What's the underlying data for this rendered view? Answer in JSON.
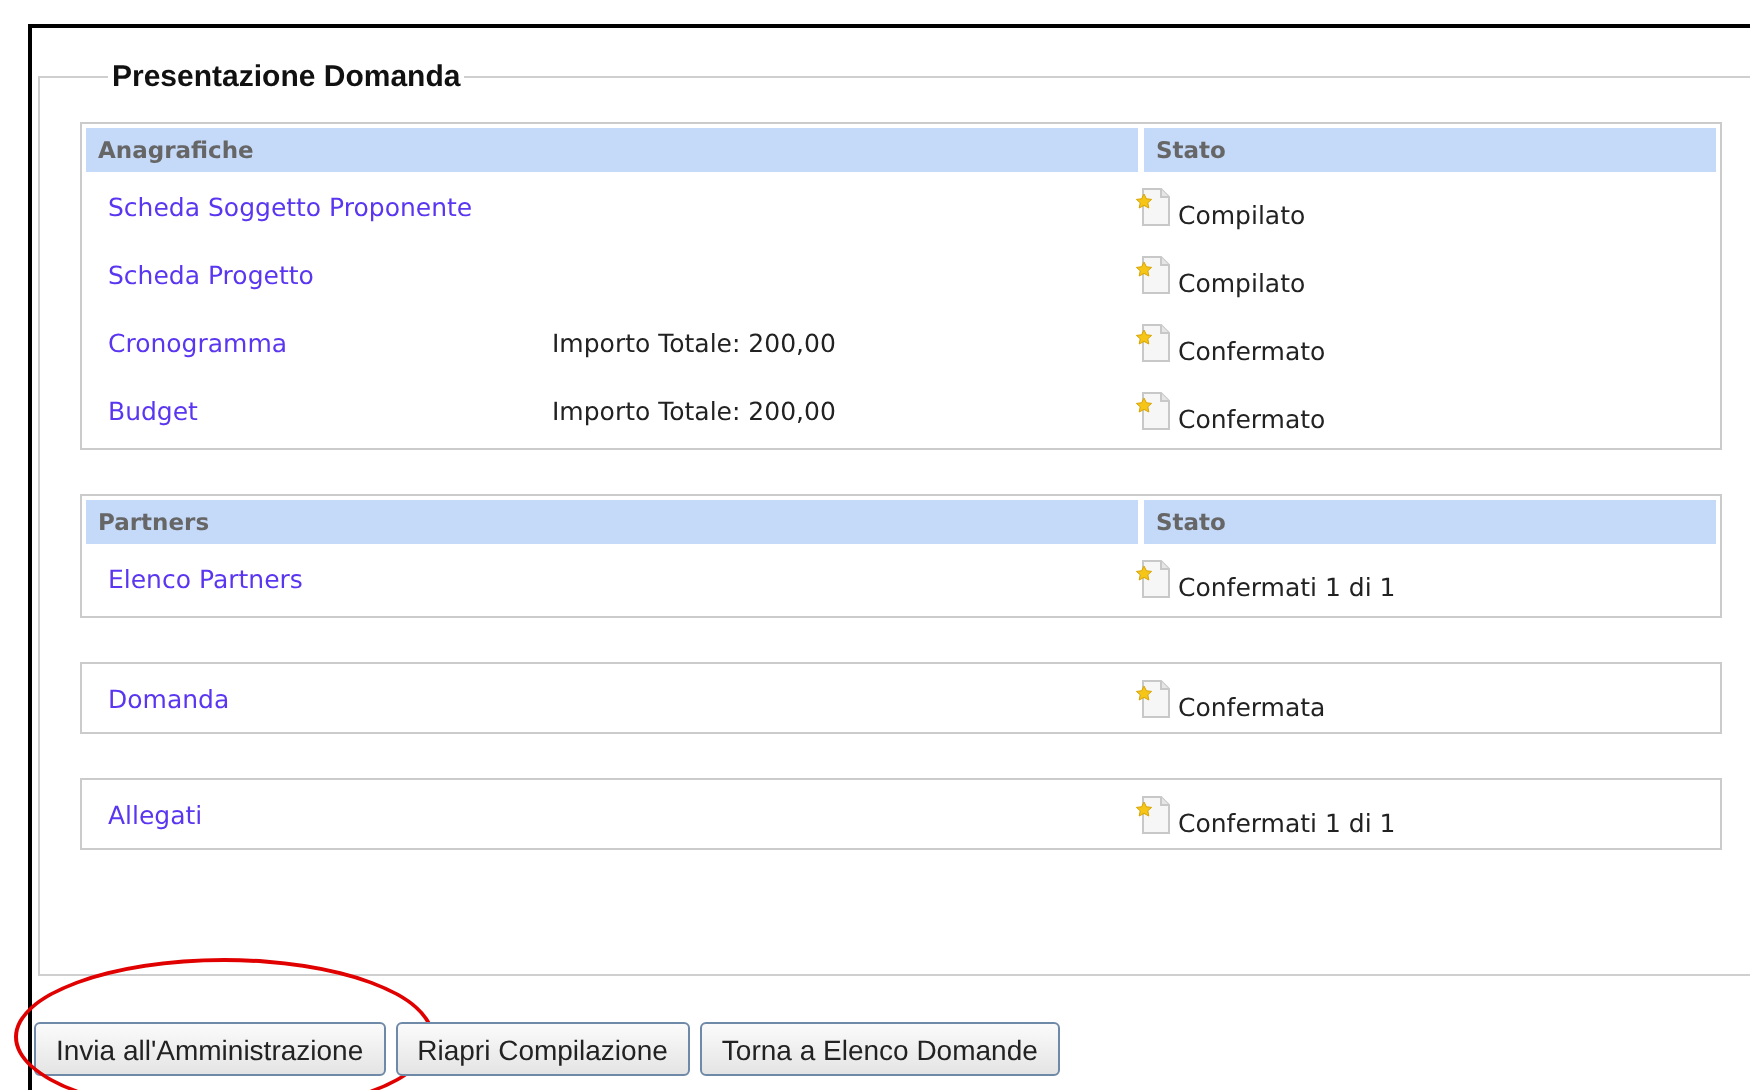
{
  "fieldset": {
    "legend": "Presentazione Domanda"
  },
  "panels": [
    {
      "columns": [
        "Anagrafiche",
        "Stato"
      ],
      "rows": [
        {
          "label": "Scheda Soggetto Proponente",
          "status": "Compilato"
        },
        {
          "label": "Scheda Progetto",
          "status": "Compilato"
        },
        {
          "label": "Cronogramma",
          "amount": "Importo Totale: 200,00",
          "status": "Confermato"
        },
        {
          "label": "Budget",
          "amount": "Importo Totale: 200,00",
          "status": "Confermato"
        }
      ]
    },
    {
      "columns": [
        "Partners",
        "Stato"
      ],
      "rows": [
        {
          "label": "Elenco Partners",
          "status": "Confermati 1 di 1"
        }
      ]
    },
    {
      "rows": [
        {
          "label": "Domanda",
          "status": "Confermata"
        }
      ]
    },
    {
      "rows": [
        {
          "label": "Allegati",
          "status": "Confermati 1 di 1"
        }
      ]
    }
  ],
  "buttons": [
    {
      "label": "Invia all'Amministrazione",
      "highlighted": true
    },
    {
      "label": "Riapri Compilazione",
      "highlighted": false
    },
    {
      "label": "Torna a Elenco Domande",
      "highlighted": false
    }
  ]
}
